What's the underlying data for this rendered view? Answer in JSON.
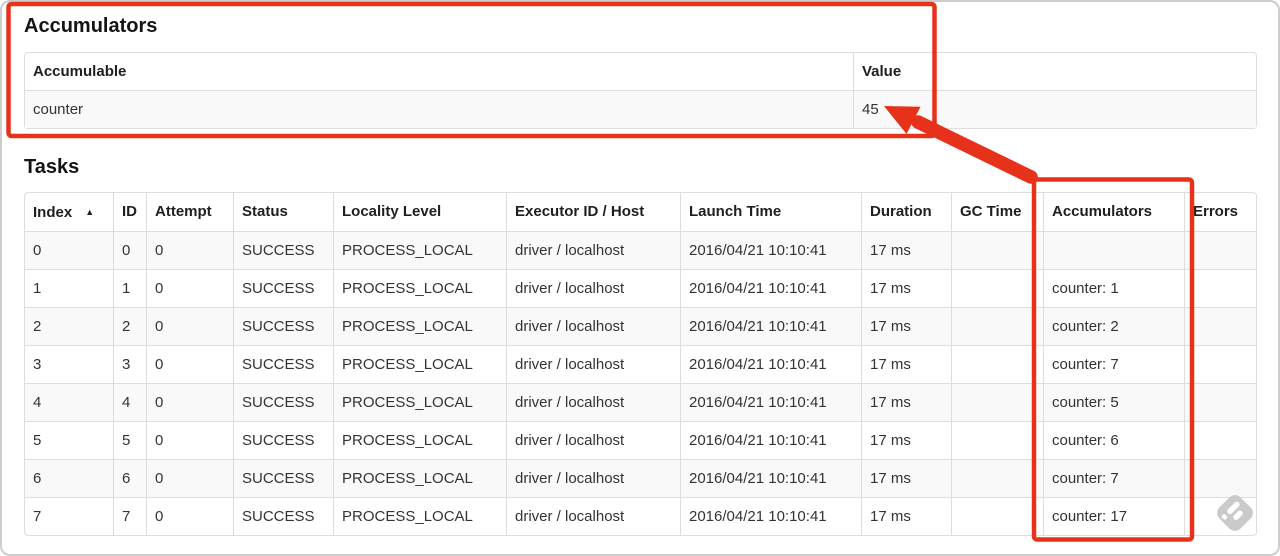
{
  "annotations": {
    "color": "#e7321b",
    "box1_target": "accumulators-summary-table",
    "box2_target": "tasks-accumulators-column",
    "arrow_target": "value-45"
  },
  "watermark": {
    "color": "#c6c6c6",
    "stripe_color": "#ffffff"
  },
  "accumulators_section": {
    "title": "Accumulators",
    "table": {
      "headers": [
        "Accumulable",
        "Value"
      ],
      "rows": [
        [
          "counter",
          "45"
        ]
      ]
    }
  },
  "tasks_section": {
    "title": "Tasks",
    "table": {
      "headers": [
        "Index",
        "ID",
        "Attempt",
        "Status",
        "Locality Level",
        "Executor ID / Host",
        "Launch Time",
        "Duration",
        "GC Time",
        "Accumulators",
        "Errors"
      ],
      "sort": {
        "column_index": 0,
        "icon": "▲"
      },
      "rows": [
        [
          "0",
          "0",
          "0",
          "SUCCESS",
          "PROCESS_LOCAL",
          "driver / localhost",
          "2016/04/21 10:10:41",
          "17 ms",
          "",
          "",
          ""
        ],
        [
          "1",
          "1",
          "0",
          "SUCCESS",
          "PROCESS_LOCAL",
          "driver / localhost",
          "2016/04/21 10:10:41",
          "17 ms",
          "",
          "counter: 1",
          ""
        ],
        [
          "2",
          "2",
          "0",
          "SUCCESS",
          "PROCESS_LOCAL",
          "driver / localhost",
          "2016/04/21 10:10:41",
          "17 ms",
          "",
          "counter: 2",
          ""
        ],
        [
          "3",
          "3",
          "0",
          "SUCCESS",
          "PROCESS_LOCAL",
          "driver / localhost",
          "2016/04/21 10:10:41",
          "17 ms",
          "",
          "counter: 7",
          ""
        ],
        [
          "4",
          "4",
          "0",
          "SUCCESS",
          "PROCESS_LOCAL",
          "driver / localhost",
          "2016/04/21 10:10:41",
          "17 ms",
          "",
          "counter: 5",
          ""
        ],
        [
          "5",
          "5",
          "0",
          "SUCCESS",
          "PROCESS_LOCAL",
          "driver / localhost",
          "2016/04/21 10:10:41",
          "17 ms",
          "",
          "counter: 6",
          ""
        ],
        [
          "6",
          "6",
          "0",
          "SUCCESS",
          "PROCESS_LOCAL",
          "driver / localhost",
          "2016/04/21 10:10:41",
          "17 ms",
          "",
          "counter: 7",
          ""
        ],
        [
          "7",
          "7",
          "0",
          "SUCCESS",
          "PROCESS_LOCAL",
          "driver / localhost",
          "2016/04/21 10:10:41",
          "17 ms",
          "",
          "counter: 17",
          ""
        ]
      ]
    }
  }
}
